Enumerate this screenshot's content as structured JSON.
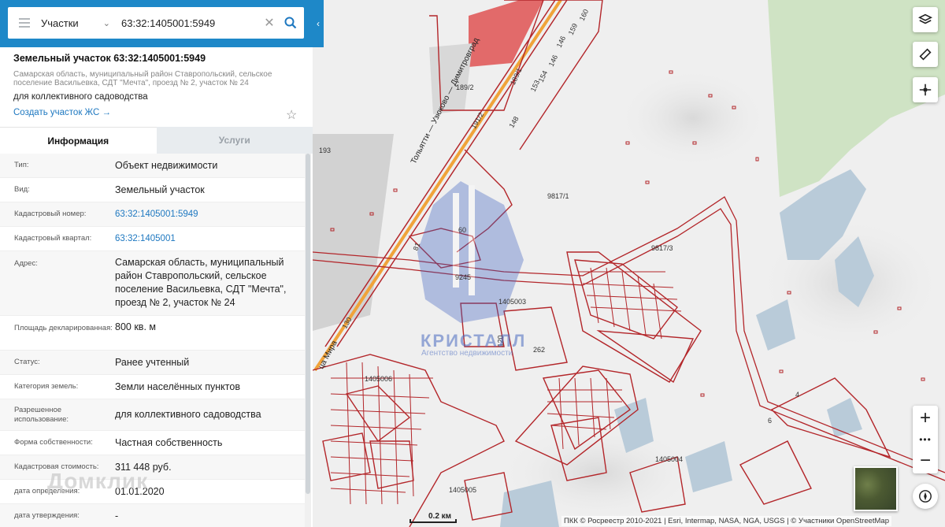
{
  "search": {
    "type_label": "Участки",
    "query": "63:32:1405001:5949"
  },
  "parcel": {
    "title": "Земельный участок 63:32:1405001:5949",
    "address_short": "Самарская область, муниципальный район Ставропольский, сельское поселение Васильевка, СДТ \"Мечта\", проезд № 2, участок № 24",
    "usage": "для коллективного садоводства",
    "create_link": "Создать участок ЖС →"
  },
  "tabs": [
    {
      "label": "Информация",
      "active": true
    },
    {
      "label": "Услуги",
      "active": false
    }
  ],
  "info": [
    {
      "key": "Тип:",
      "value": "Объект недвижимости"
    },
    {
      "key": "Вид:",
      "value": "Земельный участок"
    },
    {
      "key": "Кадастровый номер:",
      "value": "63:32:1405001:5949"
    },
    {
      "key": "Кадастровый квартал:",
      "value": "63:32:1405001"
    },
    {
      "key": "Адрес:",
      "value": "Самарская область, муниципальный район Ставропольский, сельское поселение Васильевка, СДТ \"Мечта\", проезд № 2, участок № 24"
    },
    {
      "key": "Площадь декларированная:",
      "value": "800 кв. м"
    },
    {
      "key": "Статус:",
      "value": "Ранее учтенный"
    },
    {
      "key": "Категория земель:",
      "value": "Земли населённых пунктов"
    },
    {
      "key": "Разрешенное использование:",
      "value": "для коллективного садоводства"
    },
    {
      "key": "Форма собственности:",
      "value": "Частная собственность"
    },
    {
      "key": "Кадастровая стоимость:",
      "value": "311 448 руб."
    },
    {
      "key": "дата определения:",
      "value": "01.01.2020"
    },
    {
      "key": "дата утверждения:",
      "value": "-"
    }
  ],
  "map": {
    "labels": {
      "l1": "189/2",
      "l2": "160",
      "l3": "159",
      "l4": "146",
      "l5": "146",
      "l6": "154",
      "l7": "153",
      "l8": "189/1",
      "l9": "191/2",
      "l10": "148",
      "l11": "193",
      "l12": "9817/1",
      "l13": "9817/3",
      "l14": "60",
      "l15": "81",
      "l16": "9245",
      "l17": "1405003",
      "l18": "120",
      "l19": "262",
      "l20": "1405006",
      "l21": "1405004",
      "l22": "1405005",
      "l23": "130",
      "l24": "4",
      "l25": "6",
      "road": "Тольятти — Узюково — Димитровград",
      "street": "ца Мира"
    },
    "scale": "0.2 км",
    "attribution": "ПКК © Росреестр 2010-2021 | Esri, Intermap, NASA, NGA, USGS | © Участники OpenStreetMap",
    "watermark_brand": "КРИСТАЛЛ",
    "watermark_sub": "Агентство недвижимости",
    "domclick": "Домклик",
    "colors": {
      "parcel": "#b3262a",
      "forest": "#cfe3c4",
      "water": "#b9cbd9",
      "building": "#e26a6a",
      "road": "#f0a33a"
    }
  }
}
